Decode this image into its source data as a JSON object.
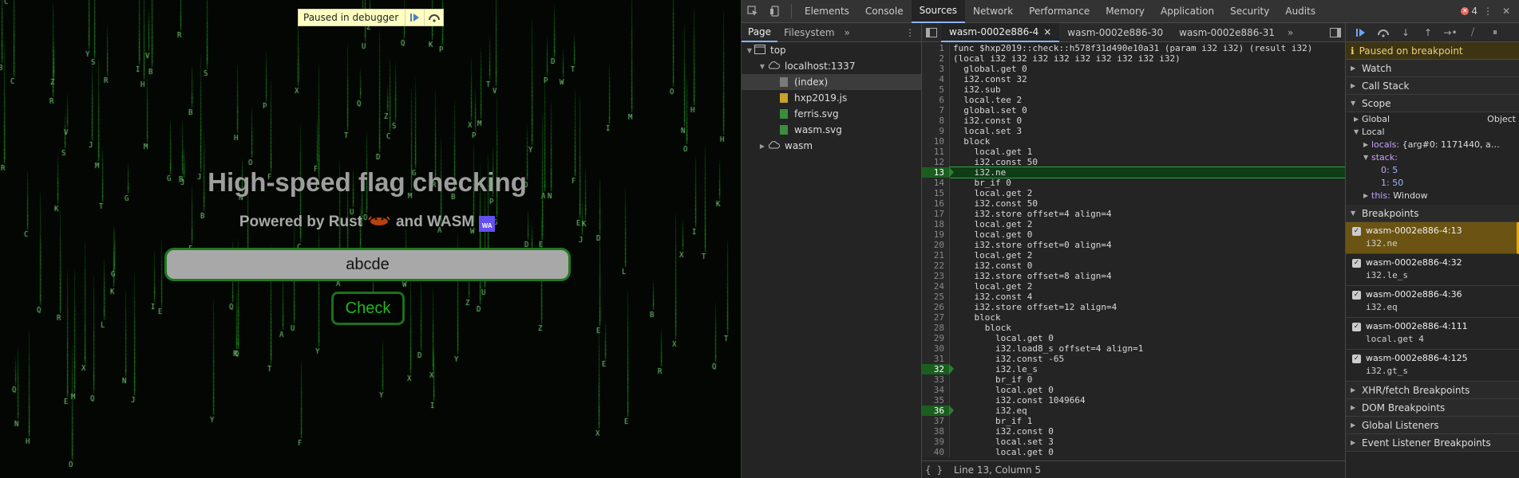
{
  "page": {
    "paused_label": "Paused in debugger",
    "headline": "High-speed flag checking",
    "subline_prefix": "Powered by Rust",
    "subline_mid": "and WASM",
    "wasm_logo_text": "WA",
    "input_value": "abcde",
    "check_label": "Check"
  },
  "devtools": {
    "tabs": [
      "Elements",
      "Console",
      "Sources",
      "Network",
      "Performance",
      "Memory",
      "Application",
      "Security",
      "Audits"
    ],
    "active_tab": "Sources",
    "error_count": "4",
    "navigator": {
      "subtabs": [
        "Page",
        "Filesystem"
      ],
      "tree": [
        {
          "label": "top",
          "indent": 0,
          "kind": "frame",
          "arrow": "down"
        },
        {
          "label": "localhost:1337",
          "indent": 1,
          "kind": "cloud",
          "arrow": "down"
        },
        {
          "label": "(index)",
          "indent": 2,
          "kind": "file-gray",
          "arrow": "",
          "selected": true
        },
        {
          "label": "hxp2019.js",
          "indent": 2,
          "kind": "file-yellow",
          "arrow": ""
        },
        {
          "label": "ferris.svg",
          "indent": 2,
          "kind": "file-green",
          "arrow": ""
        },
        {
          "label": "wasm.svg",
          "indent": 2,
          "kind": "file-green",
          "arrow": ""
        },
        {
          "label": "wasm",
          "indent": 1,
          "kind": "cloud",
          "arrow": "right"
        }
      ]
    },
    "editor": {
      "tabs": [
        "wasm-0002e886-4",
        "wasm-0002e886-30",
        "wasm-0002e886-31"
      ],
      "active_tab": "wasm-0002e886-4",
      "lines": [
        {
          "n": "1",
          "t": "func $hxp2019::check::h578f31d490e10a31 (param i32 i32) (result i32)"
        },
        {
          "n": "2",
          "t": "(local i32 i32 i32 i32 i32 i32 i32 i32 i32)"
        },
        {
          "n": "3",
          "t": "  global.get 0"
        },
        {
          "n": "4",
          "t": "  i32.const 32"
        },
        {
          "n": "5",
          "t": "  i32.sub"
        },
        {
          "n": "6",
          "t": "  local.tee 2"
        },
        {
          "n": "7",
          "t": "  global.set 0"
        },
        {
          "n": "8",
          "t": "  i32.const 0"
        },
        {
          "n": "9",
          "t": "  local.set 3"
        },
        {
          "n": "10",
          "t": "  block"
        },
        {
          "n": "11",
          "t": "    local.get 1"
        },
        {
          "n": "12",
          "t": "    i32.const 50"
        },
        {
          "n": "13",
          "t": "    i32.ne",
          "bp": true,
          "exec": true
        },
        {
          "n": "14",
          "t": "    br_if 0"
        },
        {
          "n": "15",
          "t": "    local.get 2"
        },
        {
          "n": "16",
          "t": "    i32.const 50"
        },
        {
          "n": "17",
          "t": "    i32.store offset=4 align=4"
        },
        {
          "n": "18",
          "t": "    local.get 2"
        },
        {
          "n": "19",
          "t": "    local.get 0"
        },
        {
          "n": "20",
          "t": "    i32.store offset=0 align=4"
        },
        {
          "n": "21",
          "t": "    local.get 2"
        },
        {
          "n": "22",
          "t": "    i32.const 0"
        },
        {
          "n": "23",
          "t": "    i32.store offset=8 align=4"
        },
        {
          "n": "24",
          "t": "    local.get 2"
        },
        {
          "n": "25",
          "t": "    i32.const 4"
        },
        {
          "n": "26",
          "t": "    i32.store offset=12 align=4"
        },
        {
          "n": "27",
          "t": "    block"
        },
        {
          "n": "28",
          "t": "      block"
        },
        {
          "n": "29",
          "t": "        local.get 0"
        },
        {
          "n": "30",
          "t": "        i32.load8_s offset=4 align=1"
        },
        {
          "n": "31",
          "t": "        i32.const -65"
        },
        {
          "n": "32",
          "t": "        i32.le_s",
          "bp": true
        },
        {
          "n": "33",
          "t": "        br_if 0"
        },
        {
          "n": "34",
          "t": "        local.get 0"
        },
        {
          "n": "35",
          "t": "        i32.const 1049664"
        },
        {
          "n": "36",
          "t": "        i32.eq",
          "bp": true
        },
        {
          "n": "37",
          "t": "        br_if 1"
        },
        {
          "n": "38",
          "t": "        i32.const 0"
        },
        {
          "n": "39",
          "t": "        local.set 3"
        },
        {
          "n": "40",
          "t": "        local.get 0"
        }
      ],
      "status": "Line 13, Column 5"
    },
    "debugger": {
      "paused_banner": "Paused on breakpoint",
      "watch": "Watch",
      "call_stack": "Call Stack",
      "scope": "Scope",
      "scope_global": "Global",
      "scope_global_value": "Object",
      "scope_local": "Local",
      "locals_label": "locals:",
      "locals_value": "{arg#0: 1171440, a…",
      "stack_label": "stack:",
      "stack_items": [
        {
          "k": "0:",
          "v": "5"
        },
        {
          "k": "1:",
          "v": "50"
        }
      ],
      "this_label": "this:",
      "this_value": "Window",
      "breakpoints_title": "Breakpoints",
      "breakpoints": [
        {
          "title": "wasm-0002e886-4:13",
          "code": "i32.ne",
          "hit": true
        },
        {
          "title": "wasm-0002e886-4:32",
          "code": "i32.le_s"
        },
        {
          "title": "wasm-0002e886-4:36",
          "code": "i32.eq"
        },
        {
          "title": "wasm-0002e886-4:111",
          "code": "local.get 4"
        },
        {
          "title": "wasm-0002e886-4:125",
          "code": "i32.gt_s"
        }
      ],
      "sections_after": [
        "XHR/fetch Breakpoints",
        "DOM Breakpoints",
        "Global Listeners",
        "Event Listener Breakpoints"
      ]
    }
  }
}
